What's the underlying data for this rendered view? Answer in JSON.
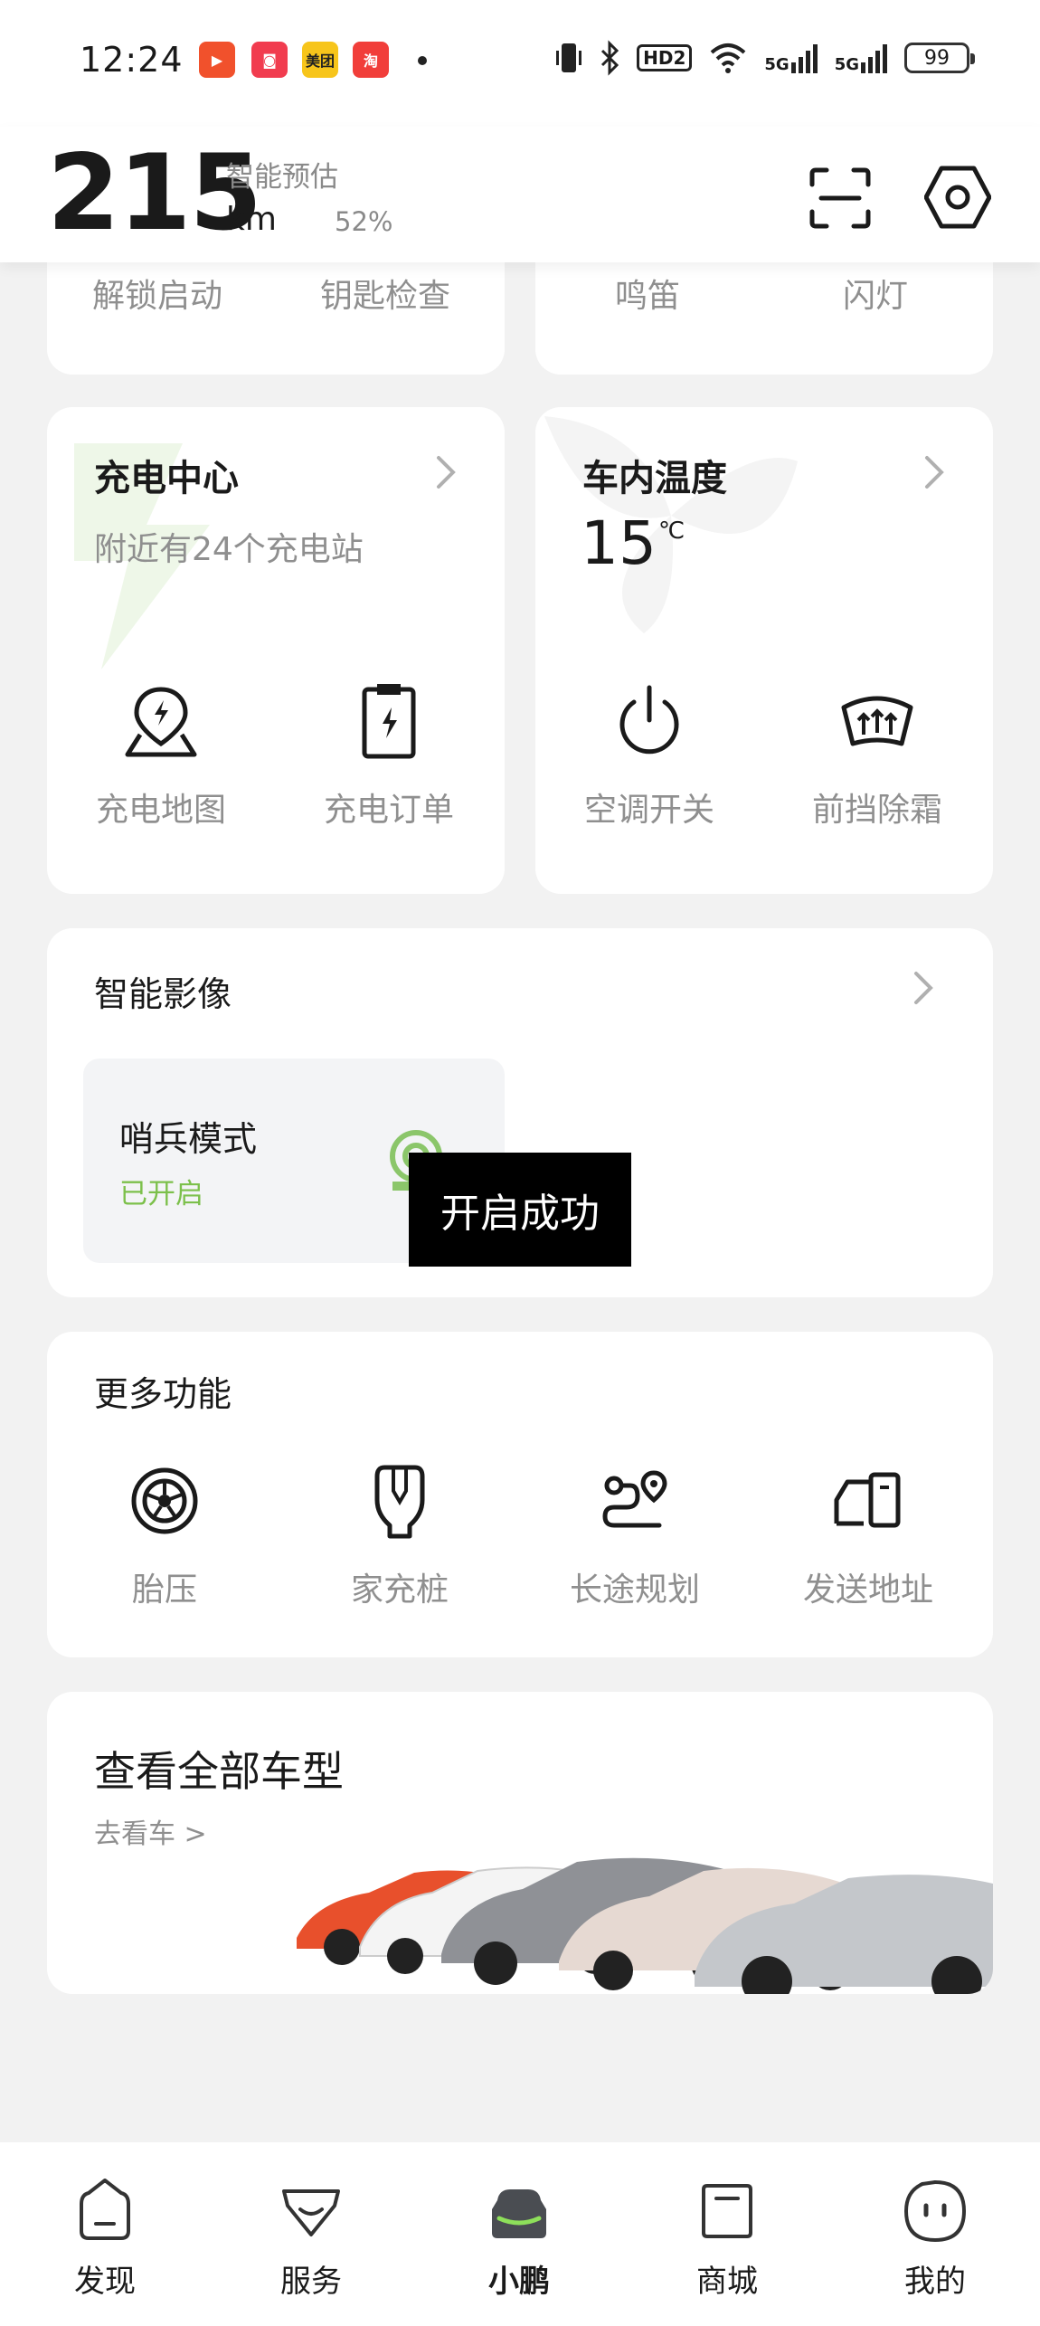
{
  "status_bar": {
    "time": "12:24",
    "app_badges": [
      {
        "icon": "video-app-icon",
        "color": "#f1512c"
      },
      {
        "icon": "gift-app-icon",
        "color": "#f13c4f"
      },
      {
        "icon": "meituan-app-icon",
        "color": "#f7c51b",
        "label": "美团"
      },
      {
        "icon": "taobao-app-icon",
        "color": "#f13e3a",
        "label": "淘"
      }
    ],
    "signal_labels": [
      "HD2",
      "5G",
      "5G"
    ],
    "battery": "99"
  },
  "header": {
    "range_value": "215",
    "range_label": "智能预估",
    "range_unit": "km",
    "battery_percent": "52%"
  },
  "quick_actions_top": {
    "left": [
      "解锁启动",
      "钥匙检查"
    ],
    "right": [
      "鸣笛",
      "闪灯"
    ]
  },
  "charging_card": {
    "title": "充电中心",
    "subtitle": "附近有24个充电站",
    "actions": [
      {
        "label": "充电地图",
        "icon": "charging-map-icon"
      },
      {
        "label": "充电订单",
        "icon": "charging-order-icon"
      }
    ]
  },
  "climate_card": {
    "title": "车内温度",
    "temperature": "15",
    "unit": "℃",
    "actions": [
      {
        "label": "空调开关",
        "icon": "power-icon"
      },
      {
        "label": "前挡除霜",
        "icon": "defrost-icon"
      }
    ]
  },
  "smart_imaging": {
    "title": "智能影像",
    "sentry_title": "哨兵模式",
    "sentry_status": "已开启"
  },
  "toast": {
    "text": "开启成功"
  },
  "more_functions": {
    "title": "更多功能",
    "items": [
      {
        "label": "胎压",
        "icon": "tire-icon"
      },
      {
        "label": "家充桩",
        "icon": "home-charger-icon"
      },
      {
        "label": "长途规划",
        "icon": "route-plan-icon"
      },
      {
        "label": "发送地址",
        "icon": "send-address-icon"
      }
    ]
  },
  "models_banner": {
    "title": "查看全部车型",
    "link": "去看车 >"
  },
  "bottom_nav": {
    "items": [
      {
        "label": "发现",
        "icon": "discover-icon"
      },
      {
        "label": "服务",
        "icon": "service-icon"
      },
      {
        "label": "小鹏",
        "icon": "car-icon",
        "active": true
      },
      {
        "label": "商城",
        "icon": "shop-icon"
      },
      {
        "label": "我的",
        "icon": "profile-icon"
      }
    ]
  },
  "colors": {
    "accent_green": "#7cc04b",
    "background": "#f2f2f2",
    "card": "#ffffff",
    "muted_text": "#8f8f8f"
  }
}
